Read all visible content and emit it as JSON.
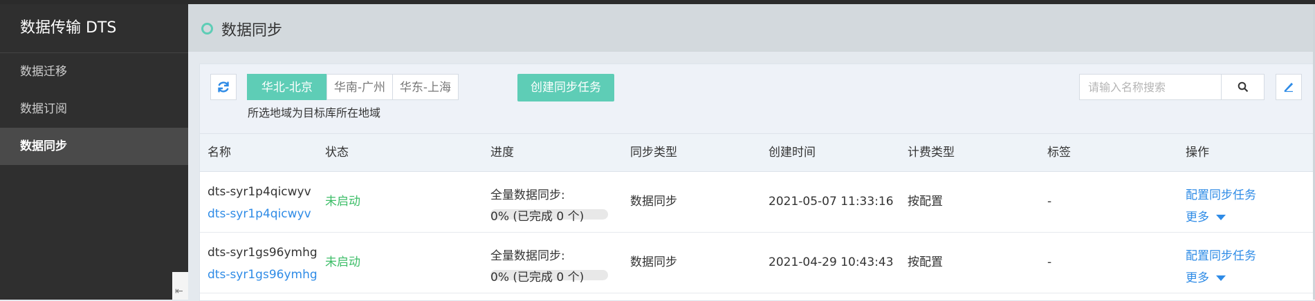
{
  "sidebar": {
    "title": "数据传输 DTS",
    "items": [
      {
        "label": "数据迁移"
      },
      {
        "label": "数据订阅"
      },
      {
        "label": "数据同步"
      }
    ]
  },
  "header": {
    "title": "数据同步"
  },
  "toolbar": {
    "regions": [
      "华北-北京",
      "华南-广州",
      "华东-上海"
    ],
    "region_note": "所选地域为目标库所在地域",
    "create_label": "创建同步任务",
    "search_placeholder": "请输入名称搜索"
  },
  "table": {
    "columns": [
      "名称",
      "状态",
      "进度",
      "同步类型",
      "创建时间",
      "计费类型",
      "标签",
      "操作"
    ],
    "rows": [
      {
        "name": "dts-syr1p4qicwyv",
        "id": "dts-syr1p4qicwyv",
        "status": "未启动",
        "progress_label": "全量数据同步:",
        "progress_text": "0% (已完成 0 个)",
        "progress_fraction": 0,
        "sync_type": "数据同步",
        "created": "2021-05-07 11:33:16",
        "billing": "按配置",
        "tag": "-",
        "action_config": "配置同步任务",
        "action_more": "更多"
      },
      {
        "name": "dts-syr1gs96ymhg",
        "id": "dts-syr1gs96ymhg",
        "status": "未启动",
        "progress_label": "全量数据同步:",
        "progress_text": "0% (已完成 0 个)",
        "progress_fraction": 0,
        "sync_type": "数据同步",
        "created": "2021-04-29 10:43:43",
        "billing": "按配置",
        "tag": "-",
        "action_config": "配置同步任务",
        "action_more": "更多"
      }
    ]
  },
  "colors": {
    "accent": "#5ecdb6",
    "link": "#2e8be6",
    "status_green": "#3cbd67",
    "sidebar_bg": "#2f2f2f"
  }
}
